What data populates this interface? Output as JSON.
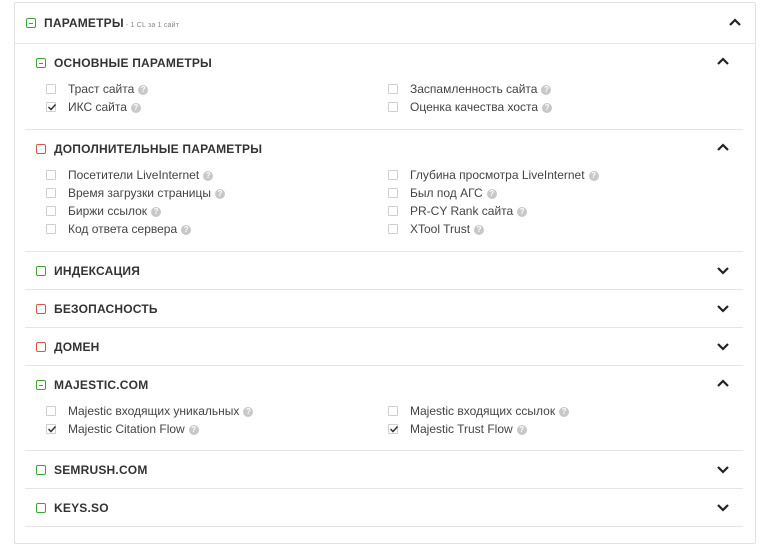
{
  "header": {
    "title": "ПАРАМЕТРЫ",
    "subtitle": "- 1 CL за 1 сайт"
  },
  "help_glyph": "?",
  "sections": [
    {
      "title": "ОСНОВНЫЕ ПАРАМЕТРЫ",
      "status_color": "green",
      "expanded": true,
      "items": [
        {
          "label": "Траст сайта",
          "checked": false
        },
        {
          "label": "Заспамленность сайта",
          "checked": false
        },
        {
          "label": "ИКС сайта",
          "checked": true
        },
        {
          "label": "Оценка качества хоста",
          "checked": false
        }
      ]
    },
    {
      "title": "ДОПОЛНИТЕЛЬНЫЕ ПАРАМЕТРЫ",
      "status_color": "red",
      "expanded": true,
      "items": [
        {
          "label": "Посетители LiveInternet",
          "checked": false
        },
        {
          "label": "Глубина просмотра LiveInternet",
          "checked": false
        },
        {
          "label": "Время загрузки страницы",
          "checked": false
        },
        {
          "label": "Был под АГС",
          "checked": false
        },
        {
          "label": "Биржи ссылок",
          "checked": false
        },
        {
          "label": "PR-CY Rank сайта",
          "checked": false
        },
        {
          "label": "Код ответа сервера",
          "checked": false
        },
        {
          "label": "XTool Trust",
          "checked": false
        }
      ]
    },
    {
      "title": "ИНДЕКСАЦИЯ",
      "status_color": "green",
      "expanded": false
    },
    {
      "title": "БЕЗОПАСНОСТЬ",
      "status_color": "red",
      "expanded": false
    },
    {
      "title": "ДОМЕН",
      "status_color": "red",
      "expanded": false
    },
    {
      "title": "MAJESTIC.COM",
      "status_color": "green",
      "expanded": true,
      "items": [
        {
          "label": "Majestic входящих уникальных",
          "checked": false
        },
        {
          "label": "Majestic входящих ссылок",
          "checked": false
        },
        {
          "label": "Majestic Citation Flow",
          "checked": true
        },
        {
          "label": "Majestic Trust Flow",
          "checked": true
        }
      ]
    },
    {
      "title": "SEMRUSH.COM",
      "status_color": "green",
      "expanded": false
    },
    {
      "title": "KEYS.SO",
      "status_color": "green",
      "expanded": false
    }
  ],
  "colors": {
    "green": "#3aa335",
    "red": "#d9534f",
    "check": "#333333"
  }
}
